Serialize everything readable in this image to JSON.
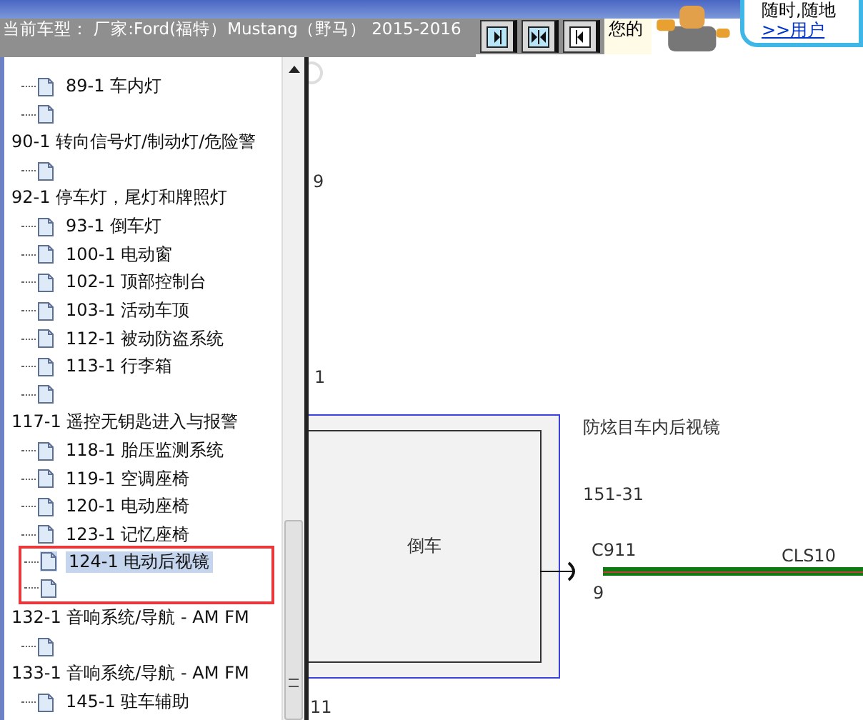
{
  "header": {
    "title": "当前车型： 厂家:Ford(福特）Mustang（野马） 2015-2016",
    "buttons": [
      {
        "kind": "right"
      },
      {
        "kind": "both"
      },
      {
        "kind": "left"
      }
    ],
    "notice": "您的",
    "promo": {
      "line": "随时,随地",
      "link": ">>用户"
    }
  },
  "tree": {
    "leading_children": [
      {
        "label": "89-1 车内灯",
        "selected": false,
        "framed": false
      },
      {
        "selected": false,
        "framed": false
      }
    ],
    "groups": [
      {
        "label": "90-1 转向信号灯/制动灯/危险警",
        "children": [
          {
            "selected": false,
            "framed": false
          }
        ]
      },
      {
        "label": "92-1 停车灯，尾灯和牌照灯",
        "children": [
          {
            "label": "93-1 倒车灯",
            "selected": false,
            "framed": false
          },
          {
            "label": "100-1 电动窗",
            "selected": false,
            "framed": false
          },
          {
            "label": "102-1 顶部控制台",
            "selected": false,
            "framed": false
          },
          {
            "label": "103-1 活动车顶",
            "selected": false,
            "framed": false
          },
          {
            "label": "112-1 被动防盗系统",
            "selected": false,
            "framed": false
          },
          {
            "label": "113-1 行李箱",
            "selected": false,
            "framed": false
          },
          {
            "selected": false,
            "framed": false
          }
        ]
      },
      {
        "label": "117-1 遥控无钥匙进入与报警",
        "children": [
          {
            "label": "118-1 胎压监测系统",
            "selected": false,
            "framed": false
          },
          {
            "label": "119-1 空调座椅",
            "selected": false,
            "framed": false
          },
          {
            "label": "120-1 电动座椅",
            "selected": false,
            "framed": false
          },
          {
            "label": "123-1 记忆座椅",
            "selected": false,
            "framed": false
          },
          {
            "label": "124-1 电动后视镜",
            "selected": true,
            "framed": true
          },
          {
            "selected": false,
            "framed": true
          }
        ]
      },
      {
        "label": "132-1 音响系统/导航 - AM FM",
        "children": [
          {
            "selected": false,
            "framed": false
          }
        ]
      },
      {
        "label": "133-1 音响系统/导航 - AM FM",
        "children": [
          {
            "label": "145-1 驻车辅助",
            "selected": false,
            "framed": false
          }
        ]
      }
    ]
  },
  "diagram": {
    "pin_labels": [
      "9",
      "1",
      "11"
    ],
    "component": "倒车",
    "component_name": "防炫目车内后视镜",
    "page_ref": "151-31",
    "connector": {
      "name": "C911",
      "pin": "9"
    },
    "wire": {
      "name": "CLS10",
      "color": "#0f7a0f"
    }
  }
}
